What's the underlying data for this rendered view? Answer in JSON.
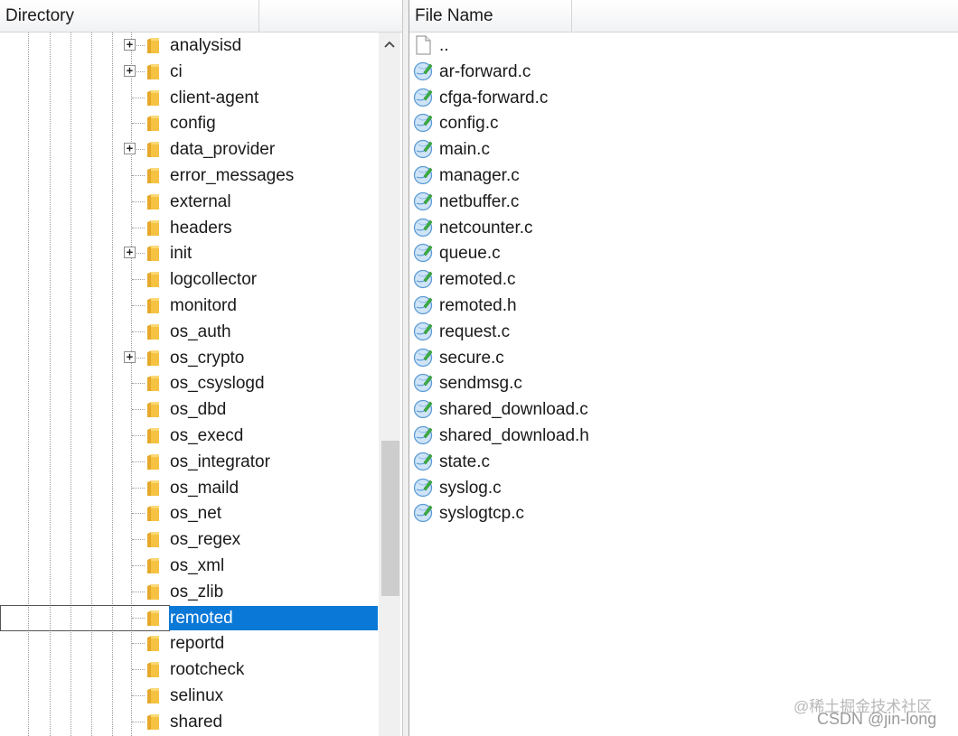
{
  "directory_pane": {
    "header": {
      "title": "Directory"
    },
    "items": [
      {
        "label": "analysisd",
        "expandable": true
      },
      {
        "label": "ci",
        "expandable": true
      },
      {
        "label": "client-agent",
        "expandable": false
      },
      {
        "label": "config",
        "expandable": false
      },
      {
        "label": "data_provider",
        "expandable": true
      },
      {
        "label": "error_messages",
        "expandable": false
      },
      {
        "label": "external",
        "expandable": false
      },
      {
        "label": "headers",
        "expandable": false
      },
      {
        "label": "init",
        "expandable": true
      },
      {
        "label": "logcollector",
        "expandable": false
      },
      {
        "label": "monitord",
        "expandable": false
      },
      {
        "label": "os_auth",
        "expandable": false
      },
      {
        "label": "os_crypto",
        "expandable": true
      },
      {
        "label": "os_csyslogd",
        "expandable": false
      },
      {
        "label": "os_dbd",
        "expandable": false
      },
      {
        "label": "os_execd",
        "expandable": false
      },
      {
        "label": "os_integrator",
        "expandable": false
      },
      {
        "label": "os_maild",
        "expandable": false
      },
      {
        "label": "os_net",
        "expandable": false
      },
      {
        "label": "os_regex",
        "expandable": false
      },
      {
        "label": "os_xml",
        "expandable": false
      },
      {
        "label": "os_zlib",
        "expandable": false
      },
      {
        "label": "remoted",
        "expandable": false,
        "selected": true
      },
      {
        "label": "reportd",
        "expandable": false
      },
      {
        "label": "rootcheck",
        "expandable": false
      },
      {
        "label": "selinux",
        "expandable": false
      },
      {
        "label": "shared",
        "expandable": false
      }
    ],
    "expander_glyph": "+",
    "scroll_up_icon": "chevron-up-icon",
    "folder_icon": "folder-icon"
  },
  "file_pane": {
    "header": {
      "title": "File Name"
    },
    "items": [
      {
        "name": "..",
        "icon": "parent-file-icon"
      },
      {
        "name": "ar-forward.c",
        "icon": "c-source-file-icon"
      },
      {
        "name": "cfga-forward.c",
        "icon": "c-source-file-icon"
      },
      {
        "name": "config.c",
        "icon": "c-source-file-icon"
      },
      {
        "name": "main.c",
        "icon": "c-source-file-icon"
      },
      {
        "name": "manager.c",
        "icon": "c-source-file-icon"
      },
      {
        "name": "netbuffer.c",
        "icon": "c-source-file-icon"
      },
      {
        "name": "netcounter.c",
        "icon": "c-source-file-icon"
      },
      {
        "name": "queue.c",
        "icon": "c-source-file-icon"
      },
      {
        "name": "remoted.c",
        "icon": "c-source-file-icon"
      },
      {
        "name": "remoted.h",
        "icon": "c-source-file-icon"
      },
      {
        "name": "request.c",
        "icon": "c-source-file-icon"
      },
      {
        "name": "secure.c",
        "icon": "c-source-file-icon"
      },
      {
        "name": "sendmsg.c",
        "icon": "c-source-file-icon"
      },
      {
        "name": "shared_download.c",
        "icon": "c-source-file-icon"
      },
      {
        "name": "shared_download.h",
        "icon": "c-source-file-icon"
      },
      {
        "name": "state.c",
        "icon": "c-source-file-icon"
      },
      {
        "name": "syslog.c",
        "icon": "c-source-file-icon"
      },
      {
        "name": "syslogtcp.c",
        "icon": "c-source-file-icon"
      }
    ]
  },
  "watermark": {
    "line1": "@稀土掘金技术社区",
    "line2": "CSDN @jin-long"
  },
  "colors": {
    "selection": "#0a78d7",
    "folder": "#f5c242",
    "file_icon_blue": "#5b9bd5",
    "file_icon_green": "#3cb043"
  }
}
